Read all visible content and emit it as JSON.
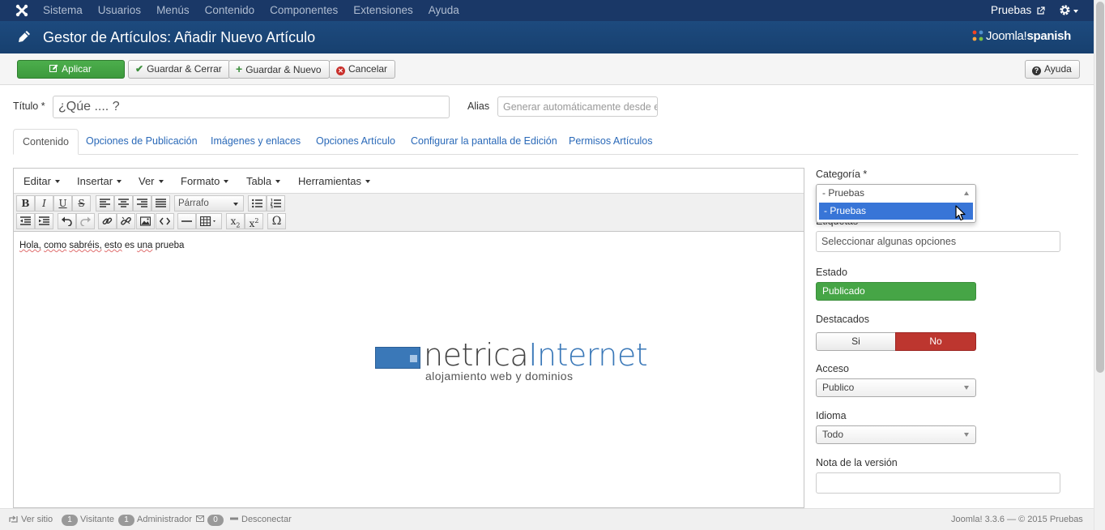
{
  "topnav": {
    "menu": [
      "Sistema",
      "Usuarios",
      "Menús",
      "Contenido",
      "Componentes",
      "Extensiones",
      "Ayuda"
    ],
    "user": "Pruebas"
  },
  "header": {
    "title": "Gestor de Artículos: Añadir Nuevo Artículo",
    "brand_joomla": "Joomla!",
    "brand_spanish": "spanish"
  },
  "toolbar": {
    "apply": "Aplicar",
    "save_close": "Guardar & Cerrar",
    "save_new": "Guardar & Nuevo",
    "cancel": "Cancelar",
    "help": "Ayuda"
  },
  "form": {
    "title_label": "Título *",
    "title_value": "¿Qúe .... ?",
    "alias_label": "Alias",
    "alias_placeholder": "Generar automáticamente desde el"
  },
  "tabs": [
    "Contenido",
    "Opciones de Publicación",
    "Imágenes y enlaces",
    "Opciones Artículo",
    "Configurar la pantalla de Edición",
    "Permisos Artículos"
  ],
  "editor": {
    "menus": [
      "Editar",
      "Insertar",
      "Ver",
      "Formato",
      "Tabla",
      "Herramientas"
    ],
    "format_select": "Párrafo",
    "words": [
      "Hola,",
      "como",
      "sabréis,",
      "esto",
      "es",
      "una",
      "prueba"
    ],
    "logo_part1": "netrica",
    "logo_part2": "Internet",
    "logo_tagline": "alojamiento web y dominios"
  },
  "sidebar": {
    "category_label": "Categoría *",
    "category_value": "- Pruebas",
    "category_option": "- Pruebas",
    "tags_label": "Etiquetas",
    "tags_placeholder": "Seleccionar algunas opciones",
    "state_label": "Estado",
    "state_value": "Publicado",
    "featured_label": "Destacados",
    "featured_yes": "Si",
    "featured_no": "No",
    "access_label": "Acceso",
    "access_value": "Publico",
    "language_label": "Idioma",
    "language_value": "Todo",
    "version_note_label": "Nota de la versión"
  },
  "footer": {
    "view_site": "Ver sitio",
    "visitors_count": "1",
    "visitors_label": "Visitante",
    "admins_count": "1",
    "admins_label": "Administrador",
    "messages_count": "0",
    "logout": "Desconectar",
    "version": "Joomla! 3.3.6  —  © 2015 Pruebas"
  },
  "colors": {
    "navbar": "#1a3867",
    "header": "#1d4a7e",
    "apply_green": "#46a546",
    "no_red": "#bd362f",
    "link_blue": "#2a69b8",
    "option_highlight": "#3875d7"
  }
}
